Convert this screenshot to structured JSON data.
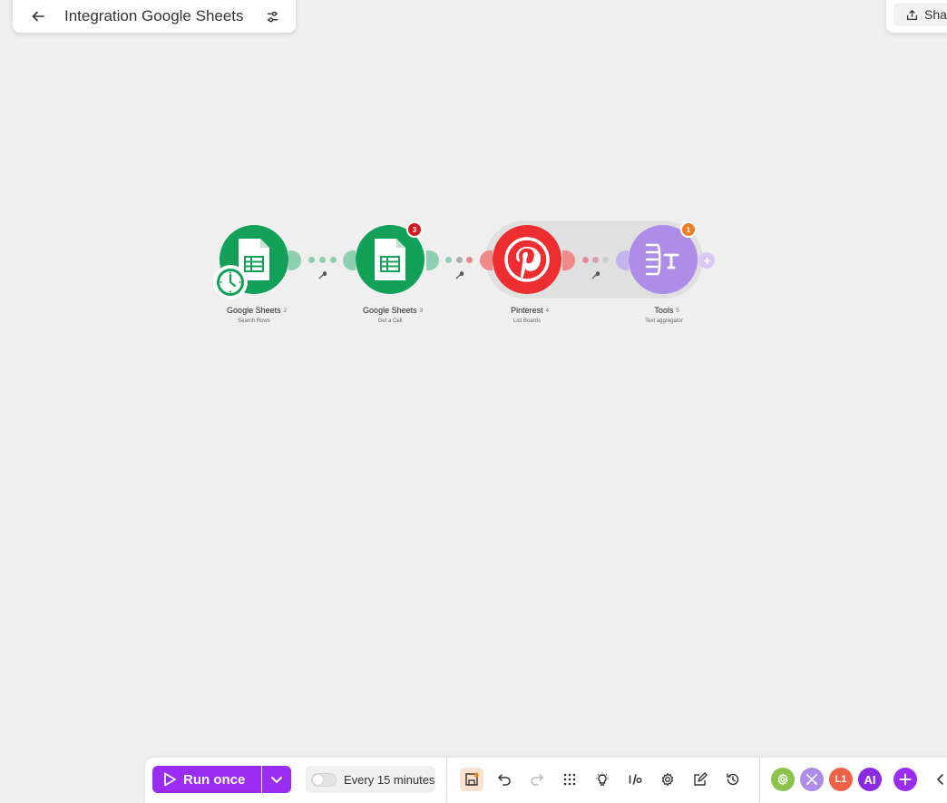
{
  "header": {
    "title": "Integration Google Sheets",
    "back_icon": "arrow-left-icon",
    "settings_icon": "sliders-icon"
  },
  "share": {
    "label": "Sha",
    "icon": "share-icon"
  },
  "scenario": {
    "modules": [
      {
        "name": "Google Sheets",
        "number": "2",
        "action": "Search Rows",
        "color": "#13a15a",
        "icon": "google-sheets-icon",
        "has_clock": true,
        "badge": ""
      },
      {
        "name": "Google Sheets",
        "number": "3",
        "action": "Get a Cell",
        "color": "#13a15a",
        "icon": "google-sheets-icon",
        "badge": "3",
        "badge_color": "#d0181e"
      },
      {
        "name": "Pinterest",
        "number": "4",
        "action": "List Boards",
        "color": "#ee2d31",
        "icon": "pinterest-icon",
        "badge": ""
      },
      {
        "name": "Tools",
        "number": "5",
        "action": "Text aggregator",
        "color": "#ad8de8",
        "icon": "text-aggregator-icon",
        "badge": "1",
        "badge_color": "#f07c24"
      }
    ],
    "add_icon": "plus-icon"
  },
  "toolbar": {
    "run_label": "Run once",
    "run_icon": "play-icon",
    "run_dropdown_icon": "chevron-down-icon",
    "schedule_label": "Every 15 minutes",
    "accent": "#9b2cf2",
    "tools": [
      "save-icon",
      "undo-icon",
      "redo-icon",
      "grid-icon",
      "bulb-icon",
      "io-icon",
      "gear-icon",
      "notes-icon",
      "history-icon"
    ],
    "apps": [
      {
        "icon": "gear-icon",
        "color": "#8bc34a"
      },
      {
        "icon": "tools-icon",
        "color": "#ad8de8"
      },
      {
        "label": "L1",
        "color": "#ee6347"
      },
      {
        "label": "AI",
        "color": "#8a2be2"
      },
      {
        "icon": "plus-icon",
        "color": "#9b2cf2"
      }
    ],
    "collapse_icon": "chevron-left-icon"
  }
}
